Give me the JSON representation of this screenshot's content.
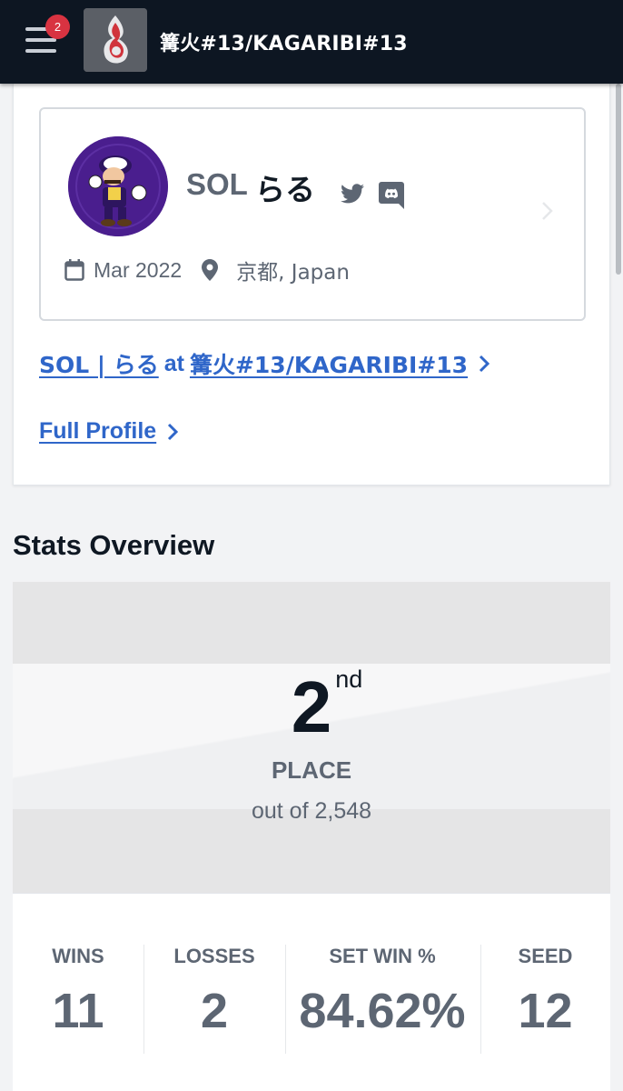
{
  "header": {
    "notification_count": "2",
    "event_title": "篝火#13/KAGARIBI#13"
  },
  "player": {
    "prefix": "SOL",
    "name": "らる",
    "joined": "Mar 2022",
    "location": "京都, Japan"
  },
  "links": {
    "entrant_prefix": "SOL | らる",
    "entrant_at": "at",
    "entrant_event": "篝火#13/KAGARIBI#13",
    "full_profile": "Full Profile"
  },
  "stats": {
    "heading": "Stats Overview",
    "placement": {
      "number": "2",
      "suffix": "nd",
      "label": "PLACE",
      "out_of": "out of 2,548"
    },
    "items": [
      {
        "label": "WINS",
        "value": "11"
      },
      {
        "label": "LOSSES",
        "value": "2"
      },
      {
        "label": "SET WIN %",
        "value": "84.62%"
      },
      {
        "label": "SEED",
        "value": "12"
      }
    ]
  },
  "icons": {
    "menu": "hamburger-menu-icon",
    "twitter": "twitter-icon",
    "discord": "discord-icon",
    "calendar": "calendar-icon",
    "location": "location-pin-icon",
    "chevron": "chevron-right-icon"
  },
  "colors": {
    "header_bg": "#0d1622",
    "link": "#2f66c9",
    "badge": "#d83341",
    "muted_text": "#5d6673"
  }
}
